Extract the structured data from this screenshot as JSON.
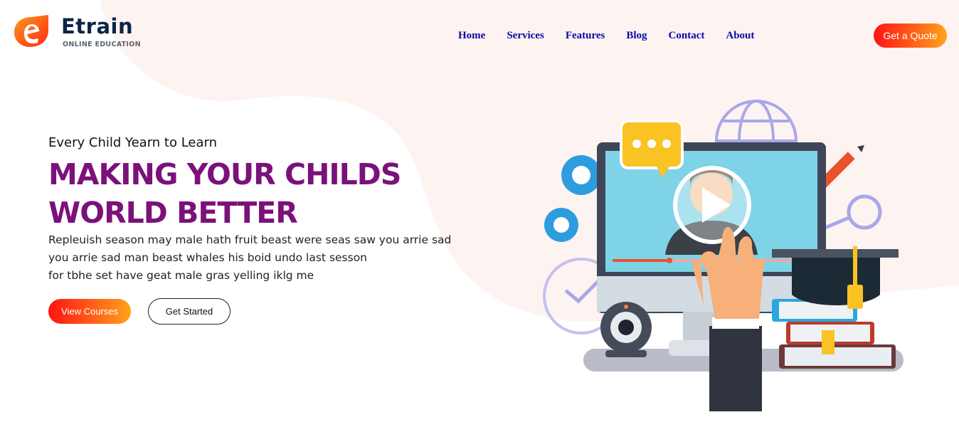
{
  "brand": {
    "name": "Etrain",
    "tagline": "ONLINE EDUCATION"
  },
  "nav": {
    "items": [
      "Home",
      "Services",
      "Features",
      "Blog",
      "Contact",
      "About"
    ]
  },
  "header": {
    "quote_label": "Get a Quote"
  },
  "hero": {
    "kicker": "Every Child Yearn to Learn",
    "title_lines": [
      "MAKING YOUR CHILDS",
      "WORLD BETTER"
    ],
    "description_lines": [
      "Repleuish season may male hath fruit beast were seas saw you arrie sad",
      "you arrie sad man beast whales his boid undo last sesson",
      "for tbhe set have geat male gras yelling iklg me"
    ],
    "primary_button": "View Courses",
    "secondary_button": "Get Started"
  },
  "colors": {
    "accent_gradient_start": "#ff1414",
    "accent_gradient_end": "#ffa51a",
    "title": "#7b117a",
    "nav_link": "#0a0aa8",
    "background_blob": "#fdf3f1"
  },
  "icons": [
    "logo-e-icon",
    "play-icon",
    "chat-bubble-icon",
    "gear-icon",
    "globe-icon",
    "pencil-icon",
    "magnifier-icon",
    "clock-icon",
    "webcam-icon",
    "graduation-cap-icon",
    "books-icon",
    "hand-pointer-icon"
  ]
}
